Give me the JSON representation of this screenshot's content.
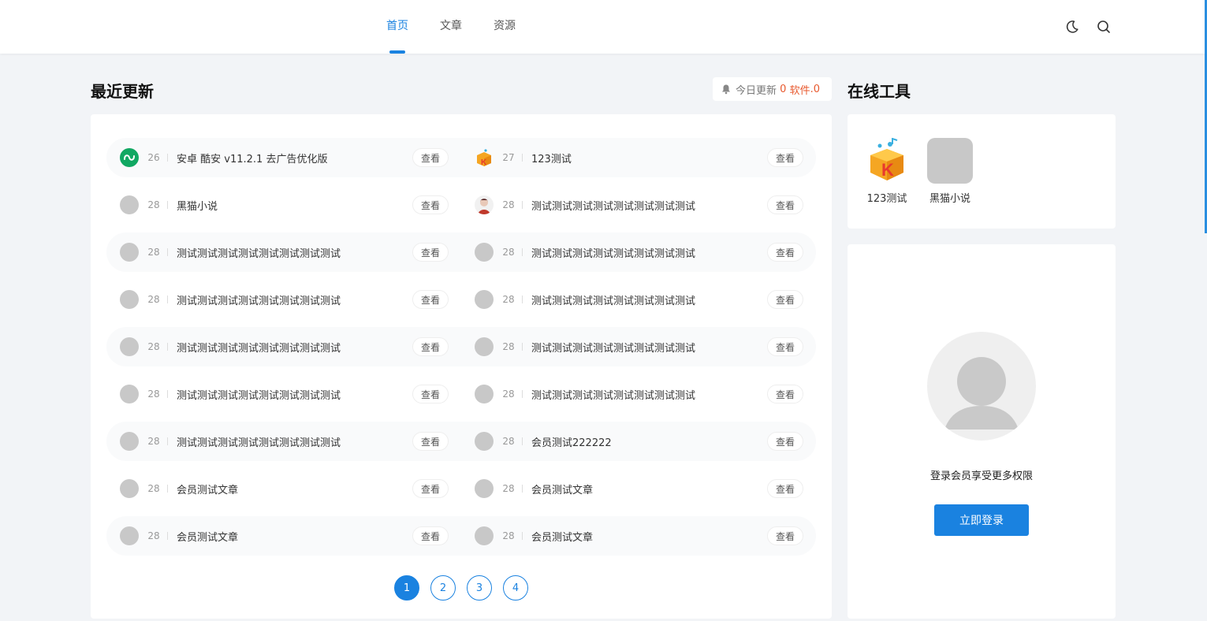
{
  "nav": {
    "items": [
      {
        "label": "首页",
        "active": true
      },
      {
        "label": "文章",
        "active": false
      },
      {
        "label": "资源",
        "active": false
      }
    ],
    "icons": [
      "moon-icon",
      "search-icon"
    ]
  },
  "recent": {
    "title": "最近更新",
    "today_label": "今日更新",
    "today_count": "0",
    "software_label": "软件",
    "software_count": "0"
  },
  "list": {
    "view_label": "查看",
    "items": [
      {
        "num": "26",
        "title": "安卓 酷安 v11.2.1 去广告优化版",
        "icon": "coolapk-icon"
      },
      {
        "num": "27",
        "title": "123测试",
        "icon": "kugou-icon"
      },
      {
        "num": "28",
        "title": "黑猫小说",
        "icon": "placeholder-icon"
      },
      {
        "num": "28",
        "title": "测试测试测试测试测试测试测试测试",
        "icon": "avatar-photo-icon"
      },
      {
        "num": "28",
        "title": "测试测试测试测试测试测试测试测试",
        "icon": "placeholder-icon"
      },
      {
        "num": "28",
        "title": "测试测试测试测试测试测试测试测试",
        "icon": "placeholder-icon"
      },
      {
        "num": "28",
        "title": "测试测试测试测试测试测试测试测试",
        "icon": "placeholder-icon"
      },
      {
        "num": "28",
        "title": "测试测试测试测试测试测试测试测试",
        "icon": "placeholder-icon"
      },
      {
        "num": "28",
        "title": "测试测试测试测试测试测试测试测试",
        "icon": "placeholder-icon"
      },
      {
        "num": "28",
        "title": "测试测试测试测试测试测试测试测试",
        "icon": "placeholder-icon"
      },
      {
        "num": "28",
        "title": "测试测试测试测试测试测试测试测试",
        "icon": "placeholder-icon"
      },
      {
        "num": "28",
        "title": "测试测试测试测试测试测试测试测试",
        "icon": "placeholder-icon"
      },
      {
        "num": "28",
        "title": "测试测试测试测试测试测试测试测试",
        "icon": "placeholder-icon"
      },
      {
        "num": "28",
        "title": "会员测试222222",
        "icon": "placeholder-icon"
      },
      {
        "num": "28",
        "title": "会员测试文章",
        "icon": "placeholder-icon"
      },
      {
        "num": "28",
        "title": "会员测试文章",
        "icon": "placeholder-icon"
      },
      {
        "num": "28",
        "title": "会员测试文章",
        "icon": "placeholder-icon"
      },
      {
        "num": "28",
        "title": "会员测试文章",
        "icon": "placeholder-icon"
      }
    ]
  },
  "pagination": {
    "pages": [
      "1",
      "2",
      "3",
      "4"
    ],
    "current": "1"
  },
  "tools": {
    "title": "在线工具",
    "items": [
      {
        "label": "123测试",
        "icon": "kugou-icon"
      },
      {
        "label": "黑猫小说",
        "icon": "placeholder-icon"
      }
    ]
  },
  "login": {
    "text": "登录会员享受更多权限",
    "button": "立即登录"
  },
  "colors": {
    "accent": "#1a82e0",
    "highlight": "#e8592e",
    "background": "#f2f4f7"
  }
}
